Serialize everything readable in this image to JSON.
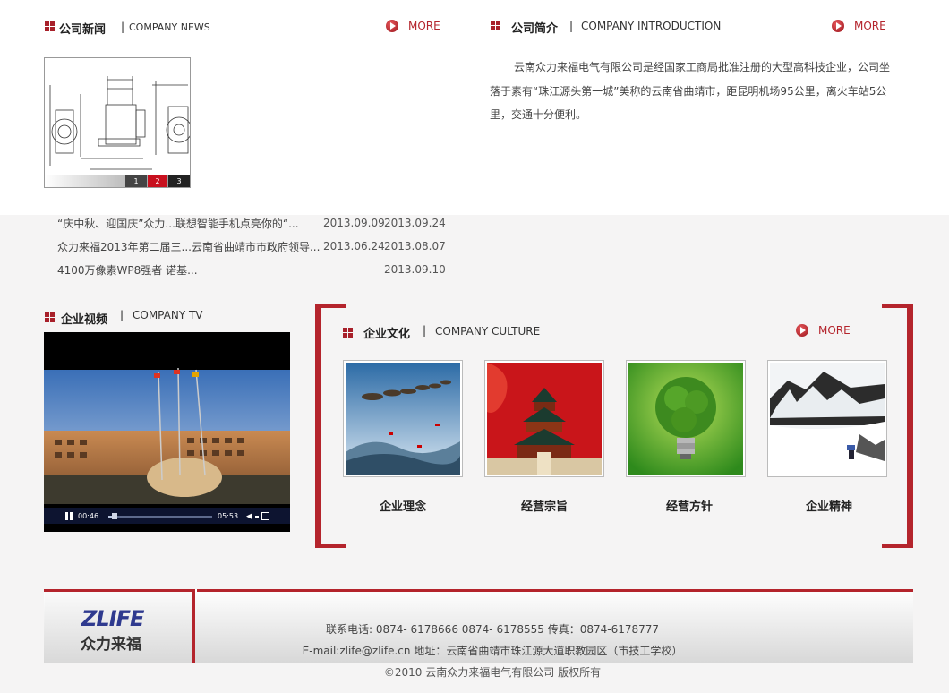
{
  "news": {
    "title_cn": "公司新闻",
    "separator": "|",
    "title_en": "COMPANY NEWS",
    "more": "MORE",
    "slider_pages": [
      "1",
      "2",
      "3"
    ],
    "items": [
      {
        "title": "“庆中秋、迎国庆”众力...联想智能手机点亮你的“...",
        "date1": "2013.09.09",
        "date2": "2013.09.24"
      },
      {
        "title": "众力来福2013年第二届三...云南省曲靖市市政府领导...",
        "date1": "2013.06.24",
        "date2": "2013.08.07"
      },
      {
        "title": "4100万像素WP8强者 诺基...",
        "date1": "",
        "date2": "2013.09.10"
      }
    ]
  },
  "intro": {
    "title_cn": "公司简介",
    "separator": "|",
    "title_en": "COMPANY INTRODUCTION",
    "more": "MORE",
    "lines": [
      "云南众力来福电气有限公司是经国家工商局批准注册的大型高科技企业，公司坐",
      "落于素有“珠江源头第一城”美称的云南省曲靖市，距昆明机场95公里，离火车站5公",
      "里，交通十分便利。"
    ]
  },
  "tv": {
    "title_cn": "企业视频",
    "separator": "|",
    "title_en": "COMPANY TV",
    "current_time": "00:46",
    "total_time": "05:53",
    "progress": 0.06,
    "volume": 0.5
  },
  "culture": {
    "title_cn": "企业文化",
    "separator": "|",
    "title_en": "COMPANY CULTURE",
    "more": "MORE",
    "items": [
      {
        "caption": "企业理念"
      },
      {
        "caption": "经营宗旨"
      },
      {
        "caption": "经营方针"
      },
      {
        "caption": "企业精神"
      }
    ]
  },
  "footer": {
    "logo_en": "ZLIFE",
    "logo_cn": "众力来福",
    "phone_line": "联系电话: 0874- 6178666 0874- 6178555 传真：0874-6178777",
    "address_line": "E-mail:zlife@zlife.cn 地址：云南省曲靖市珠江源大道职教园区（市技工学校）",
    "copyright": "©2010 云南众力来福电气有限公司 版权所有"
  },
  "colors": {
    "accent": "#a8202a",
    "more": "#b4242c"
  }
}
